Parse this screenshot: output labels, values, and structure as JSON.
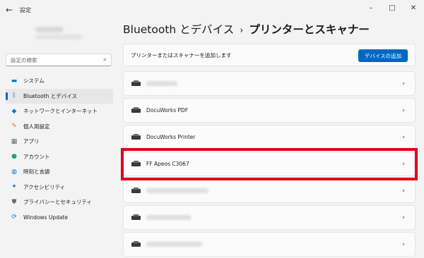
{
  "titlebar": {
    "back_icon": "arrow-left-icon",
    "title": "設定"
  },
  "window_controls": {
    "minimize": "–",
    "maximize": "□",
    "close": "✕"
  },
  "search": {
    "placeholder": "設定の検索",
    "icon": "search-icon"
  },
  "sidebar": {
    "items": [
      {
        "label": "システム",
        "icon": "monitor-icon",
        "glyph": "▬",
        "color": "#0a78d4",
        "active": false
      },
      {
        "label": "Bluetooth とデバイス",
        "icon": "bluetooth-icon",
        "glyph": "ᛒ",
        "color": "#0a78d4",
        "active": true
      },
      {
        "label": "ネットワークとインターネット",
        "icon": "wifi-icon",
        "glyph": "◆",
        "color": "#0a78d4",
        "active": false
      },
      {
        "label": "個人用設定",
        "icon": "brush-icon",
        "glyph": "✎",
        "color": "#d97b1a",
        "active": false
      },
      {
        "label": "アプリ",
        "icon": "apps-icon",
        "glyph": "▦",
        "color": "#5a6b7b",
        "active": false
      },
      {
        "label": "アカウント",
        "icon": "person-icon",
        "glyph": "●",
        "color": "#1ea672",
        "active": false
      },
      {
        "label": "時刻と言語",
        "icon": "globe-clock-icon",
        "glyph": "◍",
        "color": "#0a78d4",
        "active": false
      },
      {
        "label": "アクセシビリティ",
        "icon": "accessibility-icon",
        "glyph": "✦",
        "color": "#0a78d4",
        "active": false
      },
      {
        "label": "プライバシーとセキュリティ",
        "icon": "shield-icon",
        "glyph": "⛊",
        "color": "#6b6b6b",
        "active": false
      },
      {
        "label": "Windows Update",
        "icon": "update-icon",
        "glyph": "⟳",
        "color": "#0a78d4",
        "active": false
      }
    ]
  },
  "header": {
    "parent": "Bluetooth とデバイス",
    "separator": "›",
    "current": "プリンターとスキャナー"
  },
  "add_device": {
    "label": "プリンターまたはスキャナーを追加します",
    "button": "デバイスの追加"
  },
  "printers": [
    {
      "name": "",
      "redacted": true
    },
    {
      "name": "DocuWorks PDF",
      "redacted": false
    },
    {
      "name": "DocuWorks Printer",
      "redacted": false
    },
    {
      "name": "FF Apeos C3067",
      "redacted": false,
      "highlighted": true
    },
    {
      "name": "",
      "redacted": true
    },
    {
      "name": "",
      "redacted": true
    },
    {
      "name": "",
      "redacted": true
    }
  ],
  "chevron": "›",
  "highlight_color": "#e0001b"
}
